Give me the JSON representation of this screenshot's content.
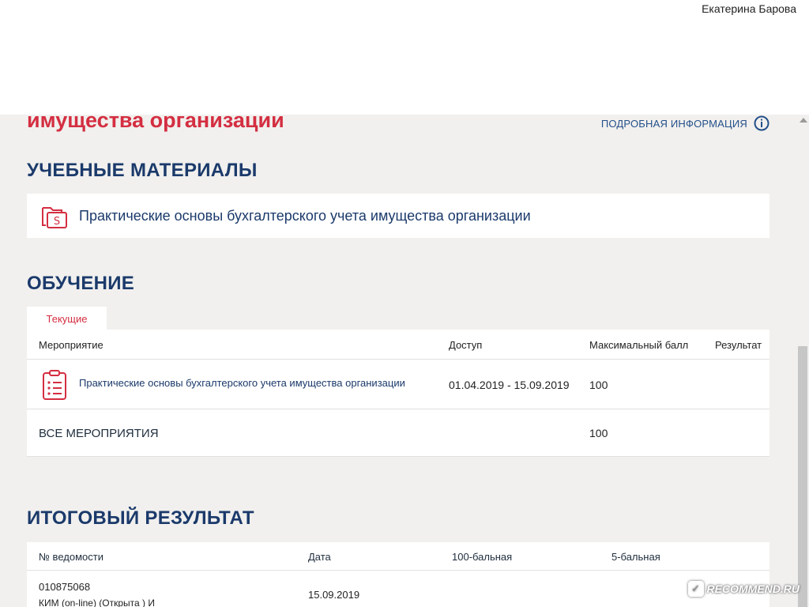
{
  "header": {
    "user_name": "Екатерина Барова"
  },
  "course": {
    "title_tail": "имущества организации",
    "more_info_label": "ПОДРОБНАЯ ИНФОРМАЦИЯ"
  },
  "materials": {
    "heading": "УЧЕБНЫЕ МАТЕРИАЛЫ",
    "items": [
      {
        "title": "Практические основы бухгалтерского учета имущества организации"
      }
    ]
  },
  "training": {
    "heading": "ОБУЧЕНИЕ",
    "tabs": [
      {
        "label": "Текущие",
        "active": true
      }
    ],
    "columns": {
      "event": "Мероприятие",
      "access": "Доступ",
      "max_score": "Максимальный балл",
      "result": "Результат"
    },
    "rows": [
      {
        "event": "Практические основы бухгалтерского учета имущества организации",
        "access": "01.04.2019 - 15.09.2019",
        "max_score": "100",
        "result": ""
      }
    ],
    "total": {
      "label": "ВСЕ МЕРОПРИЯТИЯ",
      "max_score": "100"
    }
  },
  "final": {
    "heading": "ИТОГОВЫЙ РЕЗУЛЬТАТ",
    "columns": {
      "statement_no": "№ ведомости",
      "date": "Дата",
      "score100": "100-бальная",
      "score5": "5-бальная"
    },
    "rows": [
      {
        "statement_no": "010875068",
        "statement_desc": "КИМ (on-line) (Открыта ) И",
        "date": "15.09.2019",
        "score100": "",
        "score5": ""
      }
    ]
  },
  "watermark": {
    "text": "RECOMMEND.RU",
    "icon": "recommend-logo-icon"
  },
  "colors": {
    "accent_red": "#d42e41",
    "heading_blue": "#1b3a6b",
    "link_blue": "#24508a",
    "background": "#f1f0ee"
  }
}
